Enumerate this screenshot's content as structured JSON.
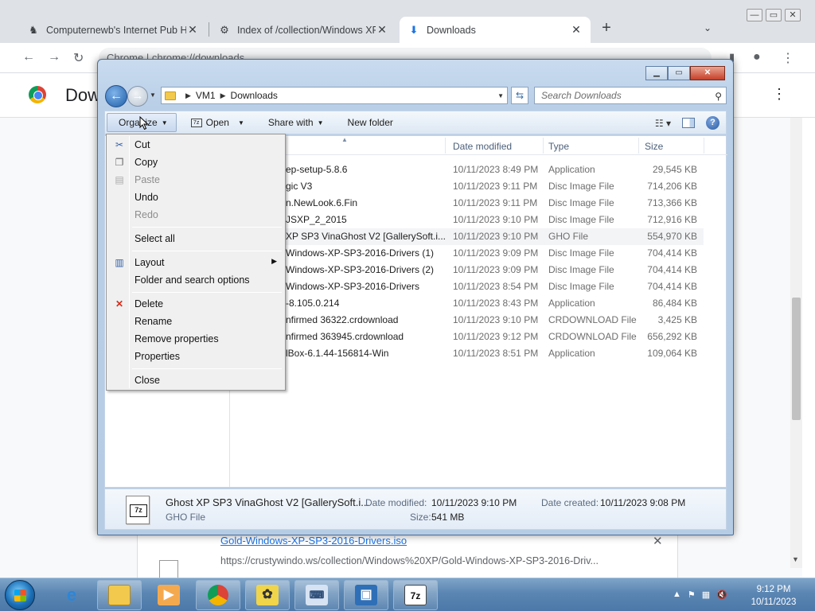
{
  "browser": {
    "tabs": [
      {
        "title": "Computernewb's Internet Pub H",
        "icon": "pub-icon",
        "close": "✕"
      },
      {
        "title": "Index of /collection/Windows XP",
        "icon": "server-icon",
        "close": "✕"
      },
      {
        "title": "Downloads",
        "icon": "download-icon",
        "close": "✕"
      }
    ],
    "new_tab": "+",
    "omnibox": "Chrome  |  chrome://downloads",
    "page_title": "Downloads",
    "download_item": {
      "filename": "Gold-Windows-XP-SP3-2016-Drivers.iso",
      "url": "https://crustywindo.ws/collection/Windows%20XP/Gold-Windows-XP-SP3-2016-Driv...",
      "remove": "✕"
    }
  },
  "explorer": {
    "breadcrumb": [
      "VM1",
      "Downloads"
    ],
    "search_placeholder": "Search Downloads",
    "commands": {
      "organize": "Organize",
      "open": "Open",
      "share_with": "Share with",
      "new_folder": "New folder"
    },
    "columns": {
      "date": "Date modified",
      "type": "Type",
      "size": "Size"
    },
    "files": [
      {
        "name": "ep-setup-5.8.6",
        "date": "10/11/2023 8:49 PM",
        "type": "Application",
        "size": "29,545 KB"
      },
      {
        "name": "gic V3",
        "date": "10/11/2023 9:11 PM",
        "type": "Disc Image File",
        "size": "714,206 KB"
      },
      {
        "name": "n.NewLook.6.Fin",
        "date": "10/11/2023 9:11 PM",
        "type": "Disc Image File",
        "size": "713,366 KB"
      },
      {
        "name": "JSXP_2_2015",
        "date": "10/11/2023 9:10 PM",
        "type": "Disc Image File",
        "size": "712,916 KB"
      },
      {
        "name": "XP SP3 VinaGhost V2 [GallerySoft.i...",
        "date": "10/11/2023 9:10 PM",
        "type": "GHO File",
        "size": "554,970 KB"
      },
      {
        "name": "Windows-XP-SP3-2016-Drivers (1)",
        "date": "10/11/2023 9:09 PM",
        "type": "Disc Image File",
        "size": "704,414 KB"
      },
      {
        "name": "Windows-XP-SP3-2016-Drivers (2)",
        "date": "10/11/2023 9:09 PM",
        "type": "Disc Image File",
        "size": "704,414 KB"
      },
      {
        "name": "Windows-XP-SP3-2016-Drivers",
        "date": "10/11/2023 8:54 PM",
        "type": "Disc Image File",
        "size": "704,414 KB"
      },
      {
        "name": "-8.105.0.214",
        "date": "10/11/2023 8:43 PM",
        "type": "Application",
        "size": "86,484 KB"
      },
      {
        "name": "nfirmed 36322.crdownload",
        "date": "10/11/2023 9:10 PM",
        "type": "CRDOWNLOAD File",
        "size": "3,425 KB"
      },
      {
        "name": "nfirmed 363945.crdownload",
        "date": "10/11/2023 9:12 PM",
        "type": "CRDOWNLOAD File",
        "size": "656,292 KB"
      },
      {
        "name": "lBox-6.1.44-156814-Win",
        "date": "10/11/2023 8:51 PM",
        "type": "Application",
        "size": "109,064 KB"
      }
    ],
    "details": {
      "name": "Ghost XP SP3 VinaGhost V2 [GallerySoft.i...",
      "kind": "GHO File",
      "date_modified_label": "Date modified:",
      "date_modified": "10/11/2023 9:10 PM",
      "date_created_label": "Date created:",
      "date_created": "10/11/2023 9:08 PM",
      "size_label": "Size:",
      "size": "541 MB"
    }
  },
  "organize_menu": {
    "cut": "Cut",
    "copy": "Copy",
    "paste": "Paste",
    "undo": "Undo",
    "redo": "Redo",
    "select_all": "Select all",
    "layout": "Layout",
    "folder_options": "Folder and search options",
    "delete": "Delete",
    "rename": "Rename",
    "remove_properties": "Remove properties",
    "properties": "Properties",
    "close": "Close"
  },
  "taskbar": {
    "clock_time": "9:12 PM",
    "clock_date": "10/11/2023",
    "pinned": [
      "internet-explorer-icon",
      "file-explorer-icon",
      "media-player-icon",
      "chrome-icon",
      "bee-icon",
      "keyboard-icon",
      "virtualbox-icon",
      "7zip-icon"
    ]
  }
}
